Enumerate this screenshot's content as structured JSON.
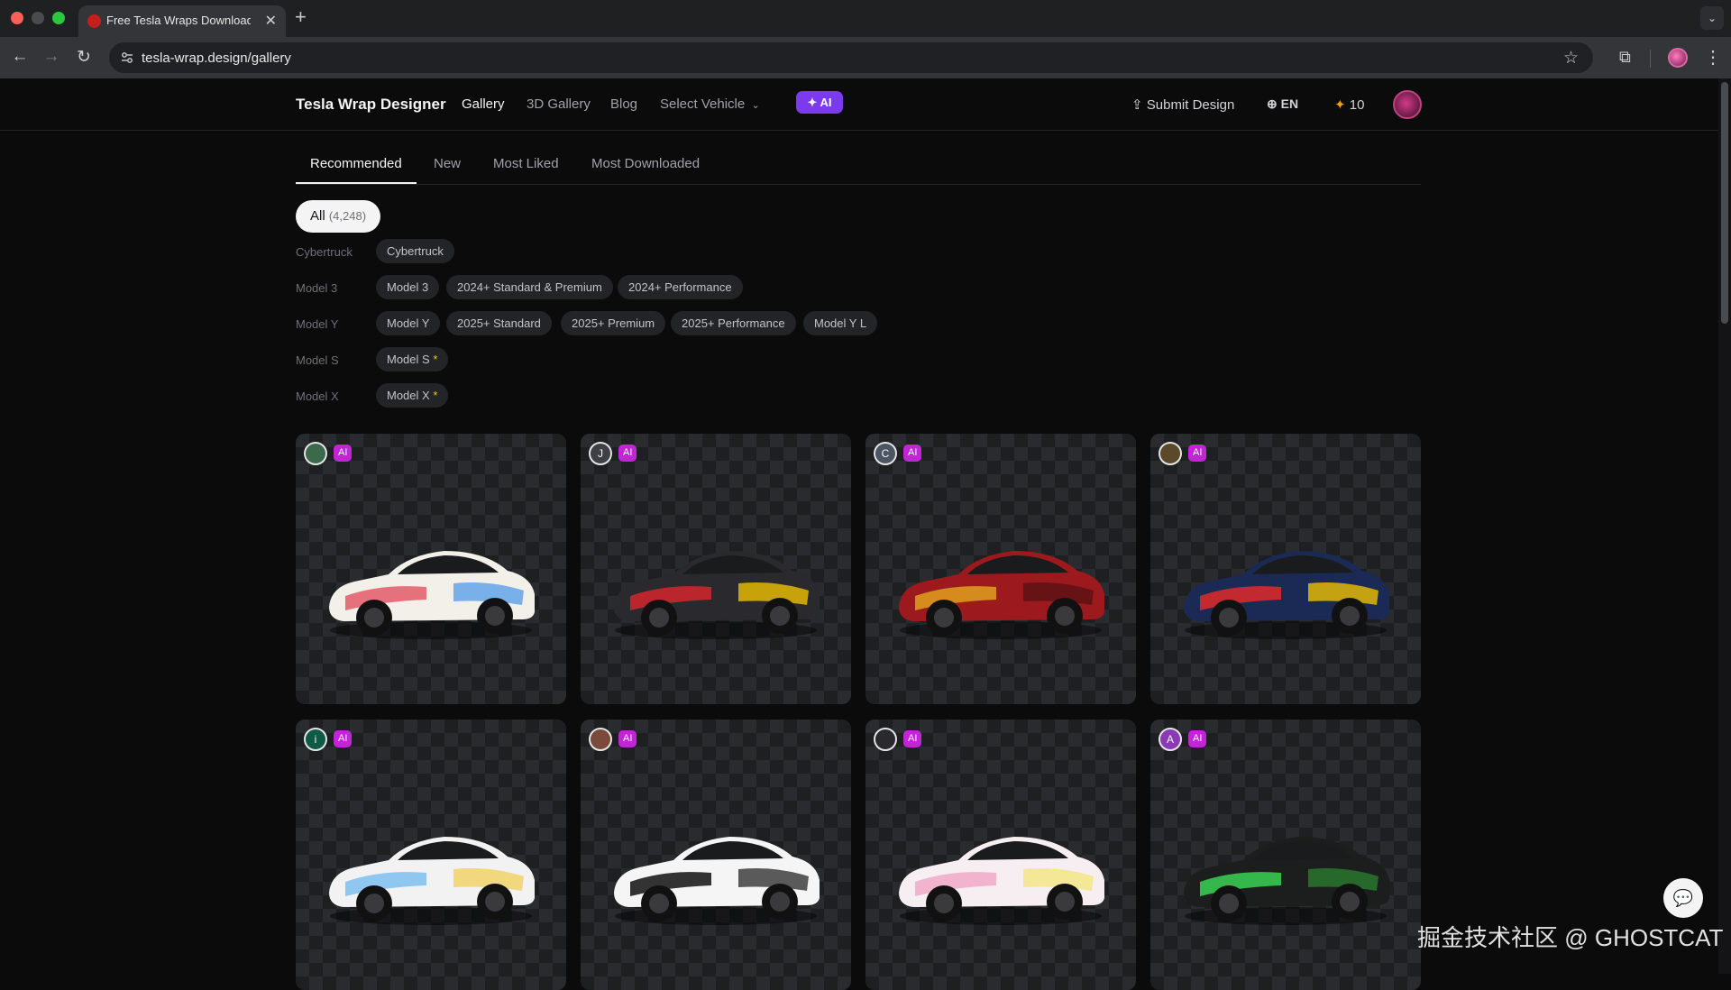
{
  "browser": {
    "tab_title": "Free Tesla Wraps Download -",
    "tab_close": "✕",
    "new_tab": "+",
    "url": "tesla-wrap.design/gallery"
  },
  "site": {
    "brand": "Tesla Wrap Designer",
    "nav": [
      "Gallery",
      "3D Gallery",
      "Blog"
    ],
    "select_vehicle": "Select Vehicle",
    "ai_label": "AI",
    "submit_design": "Submit Design",
    "language": "EN",
    "credits": "10"
  },
  "sort_tabs": [
    "Recommended",
    "New",
    "Most Liked",
    "Most Downloaded"
  ],
  "filters": {
    "all_label": "All",
    "all_count": "(4,248)",
    "groups": [
      {
        "label": "Cybertruck",
        "chips": [
          "Cybertruck"
        ]
      },
      {
        "label": "Model 3",
        "chips": [
          "Model 3",
          "2024+ Standard & Premium",
          "2024+ Performance"
        ]
      },
      {
        "label": "Model Y",
        "chips": [
          "Model Y",
          "2025+ Standard",
          "2025+ Premium",
          "2025+ Performance",
          "Model Y L"
        ]
      },
      {
        "label": "Model S",
        "chips": [
          "Model S"
        ]
      },
      {
        "label": "Model X",
        "chips": [
          "Model X"
        ]
      }
    ],
    "star_marker": "*"
  },
  "cards": [
    {
      "avatar": "",
      "badge": "AI",
      "body": "#f3efe9",
      "accent": "#e25a6a",
      "accent2": "#5aa0e8"
    },
    {
      "avatar": "J",
      "badge": "AI",
      "body": "#2a2a2e",
      "accent": "#d4262a",
      "accent2": "#f0c000"
    },
    {
      "avatar": "C",
      "badge": "AI",
      "body": "#9c1a1e",
      "accent": "#e0a020",
      "accent2": "#5a1012"
    },
    {
      "avatar": "",
      "badge": "AI",
      "body": "#1a2a55",
      "accent": "#e02a2a",
      "accent2": "#f0c000"
    },
    {
      "avatar": "i",
      "badge": "AI",
      "body": "#f2f2f2",
      "accent": "#7ec0f0",
      "accent2": "#f0d060"
    },
    {
      "avatar": "",
      "badge": "AI",
      "body": "#f5f5f5",
      "accent": "#111111",
      "accent2": "#333333"
    },
    {
      "avatar": "",
      "badge": "AI",
      "body": "#f6eef0",
      "accent": "#f0a8c8",
      "accent2": "#f4e680"
    },
    {
      "avatar": "A",
      "badge": "AI",
      "body": "#1c1e1d",
      "accent": "#39d353",
      "accent2": "#2a7a30"
    }
  ],
  "watermark": "掘金技术社区 @ GHOSTCAT",
  "colors": {
    "accent_purple": "#7c3aed",
    "ai_badge": "#c026d3"
  }
}
